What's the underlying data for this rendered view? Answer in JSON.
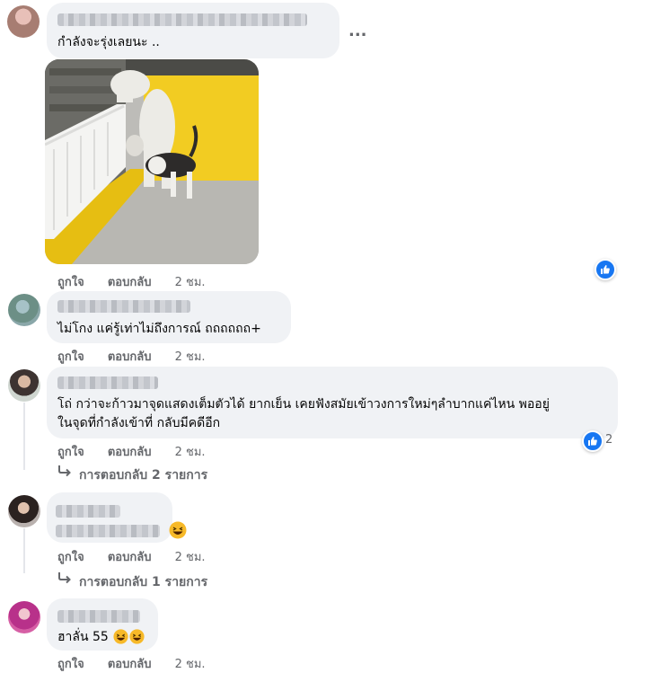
{
  "comments": [
    {
      "text": "กำลังจะรุ่งเลยนะ ..",
      "actions": {
        "like": "ถูกใจ",
        "reply": "ตอบกลับ",
        "time": "2 ชม."
      }
    },
    {
      "text": "ไม่โกง แค่รู้เท่าไม่ถึงการณ์ ถถถถถถ+",
      "actions": {
        "like": "ถูกใจ",
        "reply": "ตอบกลับ",
        "time": "2 ชม."
      }
    },
    {
      "line1": "โถ่ กว่าจะก้าวมาจุดแสดงเต็มตัวได้ ยากเย็น เคยฟังสมัยเข้าวงการใหม่ๆลำบากแค่ไหน พออยู่",
      "line2": "ในจุดที่กำลังเข้าที่ กลับมีคดีอีก",
      "reaction_count": "2",
      "actions": {
        "like": "ถูกใจ",
        "reply": "ตอบกลับ",
        "time": "2 ชม."
      },
      "replies_label": "การตอบกลับ 2 รายการ"
    },
    {
      "actions": {
        "like": "ถูกใจ",
        "reply": "ตอบกลับ",
        "time": "2 ชม."
      },
      "replies_label": "การตอบกลับ 1 รายการ"
    },
    {
      "text": "ฮาลั่น 55",
      "actions": {
        "like": "ถูกใจ",
        "reply": "ตอบกลับ",
        "time": "2 ชม."
      }
    }
  ],
  "more_menu": "...",
  "icons": {
    "more": "more-horizontal-icon",
    "like_reaction": "like-reaction-icon",
    "laugh_reaction": "laugh-emoji-icon",
    "reply_arrow": "reply-arrow-icon"
  },
  "colors": {
    "bubble": "#f0f2f5",
    "like_blue": "#1877f2",
    "meta_gray": "#65676b",
    "wall_yellow": "#f2cc22"
  }
}
